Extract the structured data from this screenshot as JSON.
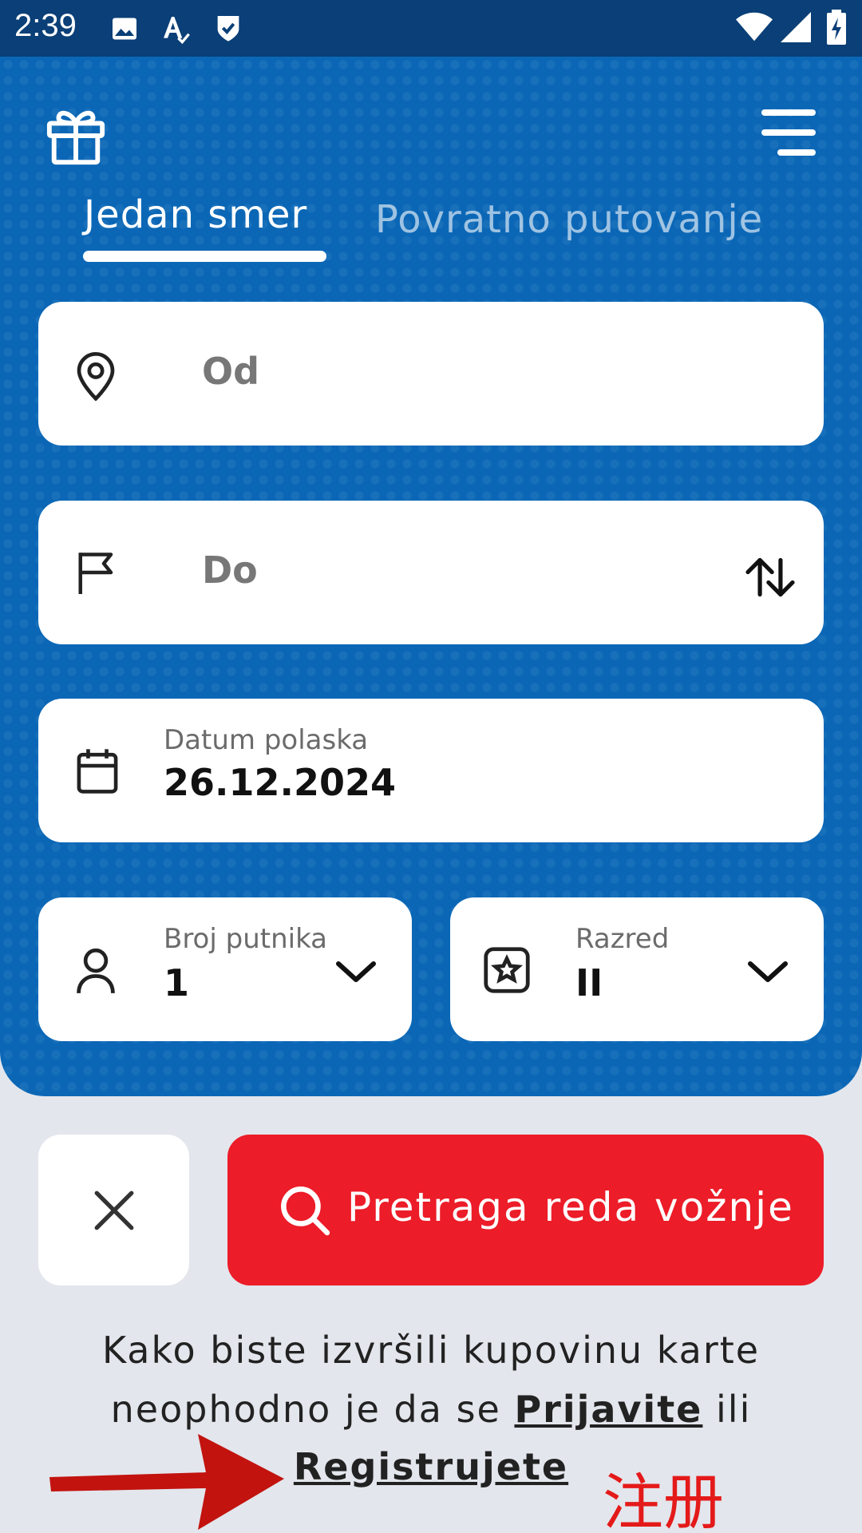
{
  "status_bar": {
    "time": "2:39"
  },
  "tabs": [
    {
      "label": "Jedan smer",
      "active": true
    },
    {
      "label": "Povratno putovanje",
      "active": false
    }
  ],
  "form": {
    "from": {
      "placeholder": "Od"
    },
    "to": {
      "placeholder": "Do"
    },
    "date": {
      "label": "Datum polaska",
      "value": "26.12.2024"
    },
    "passengers": {
      "label": "Broj putnika",
      "value": "1"
    },
    "class": {
      "label": "Razred",
      "value": "II"
    }
  },
  "actions": {
    "search_label": "Pretraga reda vožnje"
  },
  "info": {
    "line1": "Kako biste izvršili kupovinu karte",
    "line2_before": "neophodno je da se",
    "login_link": "Prijavite",
    "line2_after": "ili",
    "register_link": "Registrujete"
  },
  "annotation": {
    "text": "注册"
  },
  "colors": {
    "primary_blue": "#0b67b6",
    "status_bar": "#0a3f77",
    "accent_red": "#ec1c28",
    "background": "#e3e6ec"
  },
  "icons": [
    "gallery-icon",
    "text-icon",
    "shield-check-icon",
    "wifi-icon",
    "signal-icon",
    "battery-icon",
    "gift-icon",
    "menu-icon",
    "location-pin-icon",
    "flag-icon",
    "swap-icon",
    "calendar-icon",
    "person-icon",
    "star-ticket-icon",
    "chevron-down-icon",
    "close-icon",
    "search-icon"
  ]
}
